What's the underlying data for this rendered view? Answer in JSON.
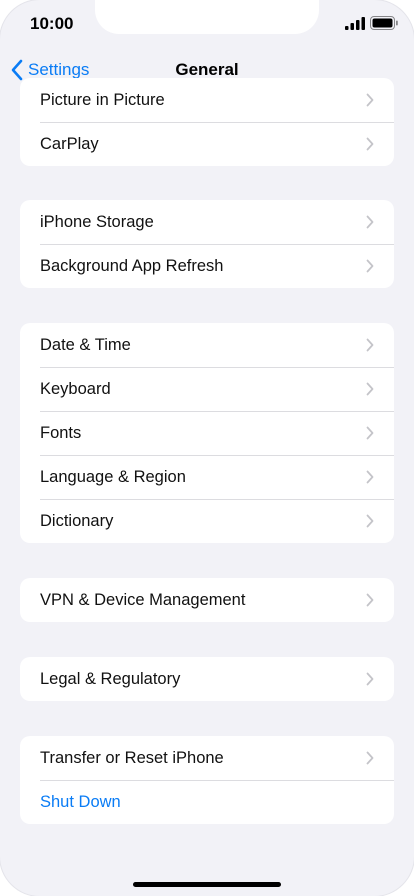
{
  "status_bar": {
    "time": "10:00",
    "icons": [
      "signal-icon",
      "battery-icon"
    ]
  },
  "nav": {
    "back_label": "Settings",
    "title": "General"
  },
  "groups": [
    {
      "rows": [
        {
          "label": "Picture in Picture"
        },
        {
          "label": "CarPlay"
        }
      ]
    },
    {
      "rows": [
        {
          "label": "iPhone Storage"
        },
        {
          "label": "Background App Refresh"
        }
      ]
    },
    {
      "rows": [
        {
          "label": "Date & Time"
        },
        {
          "label": "Keyboard"
        },
        {
          "label": "Fonts"
        },
        {
          "label": "Language & Region"
        },
        {
          "label": "Dictionary"
        }
      ]
    },
    {
      "rows": [
        {
          "label": "VPN & Device Management"
        }
      ]
    },
    {
      "rows": [
        {
          "label": "Legal & Regulatory"
        }
      ]
    },
    {
      "rows": [
        {
          "label": "Transfer or Reset iPhone"
        },
        {
          "label": "Shut Down"
        }
      ]
    }
  ],
  "colors": {
    "accent": "#0a7cf5",
    "background": "#f2f2f7",
    "card": "#ffffff",
    "chevron": "#c4c4c9"
  }
}
